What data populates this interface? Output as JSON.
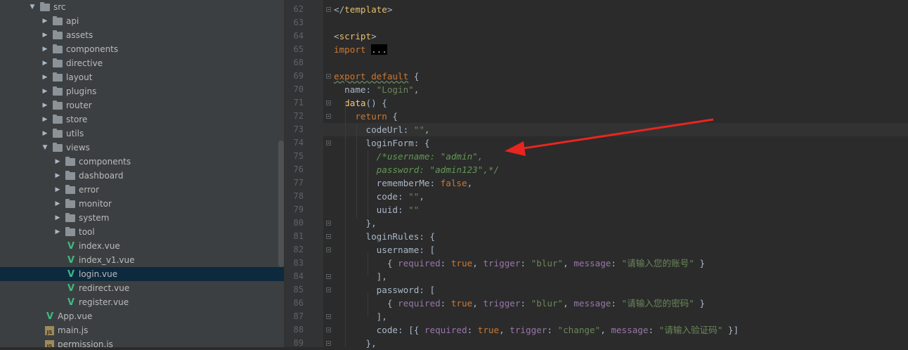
{
  "tree": {
    "items": [
      {
        "label": "src",
        "type": "folder",
        "open": true
      },
      {
        "label": "api",
        "type": "folder"
      },
      {
        "label": "assets",
        "type": "folder"
      },
      {
        "label": "components",
        "type": "folder"
      },
      {
        "label": "directive",
        "type": "folder"
      },
      {
        "label": "layout",
        "type": "folder"
      },
      {
        "label": "plugins",
        "type": "folder"
      },
      {
        "label": "router",
        "type": "folder"
      },
      {
        "label": "store",
        "type": "folder"
      },
      {
        "label": "utils",
        "type": "folder"
      },
      {
        "label": "views",
        "type": "folder",
        "open": true
      },
      {
        "label": "components",
        "type": "folder"
      },
      {
        "label": "dashboard",
        "type": "folder"
      },
      {
        "label": "error",
        "type": "folder"
      },
      {
        "label": "monitor",
        "type": "folder"
      },
      {
        "label": "system",
        "type": "folder"
      },
      {
        "label": "tool",
        "type": "folder"
      },
      {
        "label": "index.vue",
        "type": "vue"
      },
      {
        "label": "index_v1.vue",
        "type": "vue"
      },
      {
        "label": "login.vue",
        "type": "vue",
        "selected": true
      },
      {
        "label": "redirect.vue",
        "type": "vue"
      },
      {
        "label": "register.vue",
        "type": "vue"
      },
      {
        "label": "App.vue",
        "type": "vue"
      },
      {
        "label": "main.js",
        "type": "js"
      },
      {
        "label": "permission.js",
        "type": "js"
      }
    ]
  },
  "editor": {
    "lines": [
      {
        "n": "62",
        "text": "</template>"
      },
      {
        "n": "63",
        "text": ""
      },
      {
        "n": "64",
        "text": "<script>"
      },
      {
        "n": "65",
        "text": "import ..."
      },
      {
        "n": "68",
        "text": ""
      },
      {
        "n": "69",
        "text": "export default {"
      },
      {
        "n": "70",
        "text": "  name: \"Login\","
      },
      {
        "n": "71",
        "text": "  data() {"
      },
      {
        "n": "72",
        "text": "    return {"
      },
      {
        "n": "73",
        "text": "      codeUrl: \"\","
      },
      {
        "n": "74",
        "text": "      loginForm: {"
      },
      {
        "n": "75",
        "text": "        /*username: \"admin\","
      },
      {
        "n": "76",
        "text": "        password: \"admin123\",*/"
      },
      {
        "n": "77",
        "text": "        rememberMe: false,"
      },
      {
        "n": "78",
        "text": "        code: \"\","
      },
      {
        "n": "79",
        "text": "        uuid: \"\""
      },
      {
        "n": "80",
        "text": "      },"
      },
      {
        "n": "81",
        "text": "      loginRules: {"
      },
      {
        "n": "82",
        "text": "        username: ["
      },
      {
        "n": "83",
        "text": "          { required: true, trigger: \"blur\", message: \"请输入您的账号\" }"
      },
      {
        "n": "84",
        "text": "        ],"
      },
      {
        "n": "85",
        "text": "        password: ["
      },
      {
        "n": "86",
        "text": "          { required: true, trigger: \"blur\", message: \"请输入您的密码\" }"
      },
      {
        "n": "87",
        "text": "        ],"
      },
      {
        "n": "88",
        "text": "        code: [{ required: true, trigger: \"change\", message: \"请输入验证码\" }]"
      },
      {
        "n": "89",
        "text": "      },"
      }
    ]
  },
  "colors": {
    "keyword": "#cc7832",
    "string": "#6a8759",
    "property": "#9876aa",
    "comment": "#629755",
    "annotation_arrow": "#e8251f"
  }
}
